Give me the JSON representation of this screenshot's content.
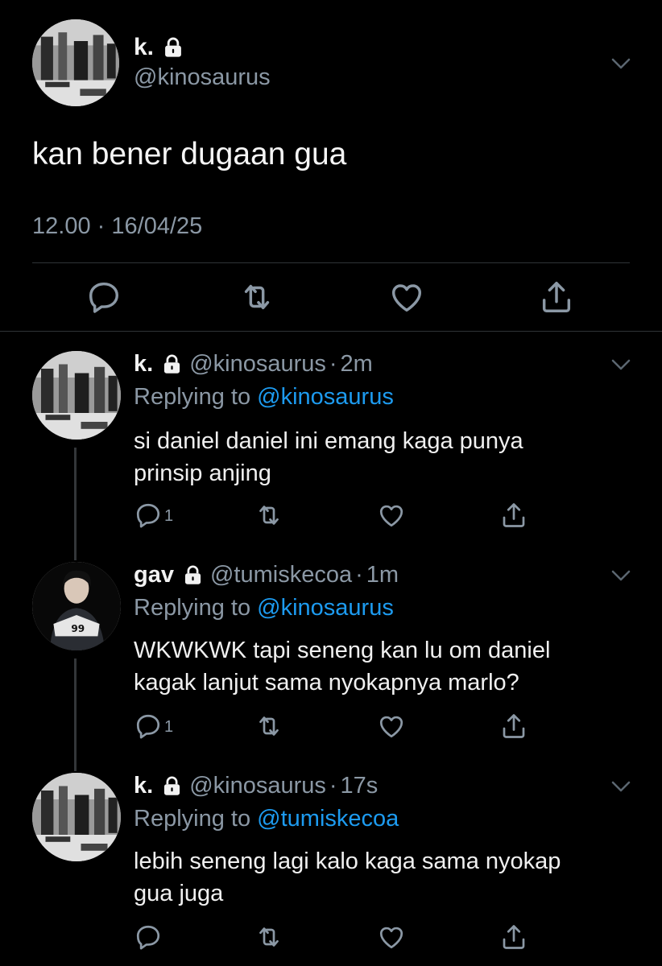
{
  "main_tweet": {
    "name": "k.",
    "handle": "@kinosaurus",
    "text": "kan bener dugaan gua",
    "time": "12.00",
    "separator": "·",
    "date": "16/04/25",
    "icons": {
      "lock": "lock-icon",
      "more": "chevron-down-icon",
      "reply": "reply-icon",
      "retweet": "retweet-icon",
      "like": "heart-icon",
      "share": "share-icon"
    }
  },
  "replies": [
    {
      "name": "k.",
      "handle": "@kinosaurus",
      "separator": "·",
      "time": "2m",
      "replying_prefix": "Replying to",
      "replying_to": "@kinosaurus",
      "text_line1": "si daniel daniel ini emang kaga punya",
      "text_line2": "prinsip anjing",
      "reply_count": "1",
      "avatar": "bw-photo-avatar"
    },
    {
      "name": "gav",
      "handle": "@tumiskecoa",
      "separator": "·",
      "time": "1m",
      "replying_prefix": "Replying to",
      "replying_to": "@kinosaurus",
      "text_line1": "WKWKWK tapi seneng kan lu om daniel",
      "text_line2": "kagak lanjut sama nyokapnya marlo?",
      "reply_count": "1",
      "avatar": "dark-photo-avatar"
    },
    {
      "name": "k.",
      "handle": "@kinosaurus",
      "separator": "·",
      "time": "17s",
      "replying_prefix": "Replying to",
      "replying_to": "@tumiskecoa",
      "text_line1": "lebih seneng lagi kalo kaga sama nyokap",
      "text_line2": "gua juga",
      "reply_count": "",
      "avatar": "bw-photo-avatar"
    }
  ],
  "colors": {
    "background": "#000000",
    "text": "#e7e9ea",
    "secondary": "#8b98a5",
    "link": "#1d9bf0",
    "divider": "#2f3336"
  }
}
